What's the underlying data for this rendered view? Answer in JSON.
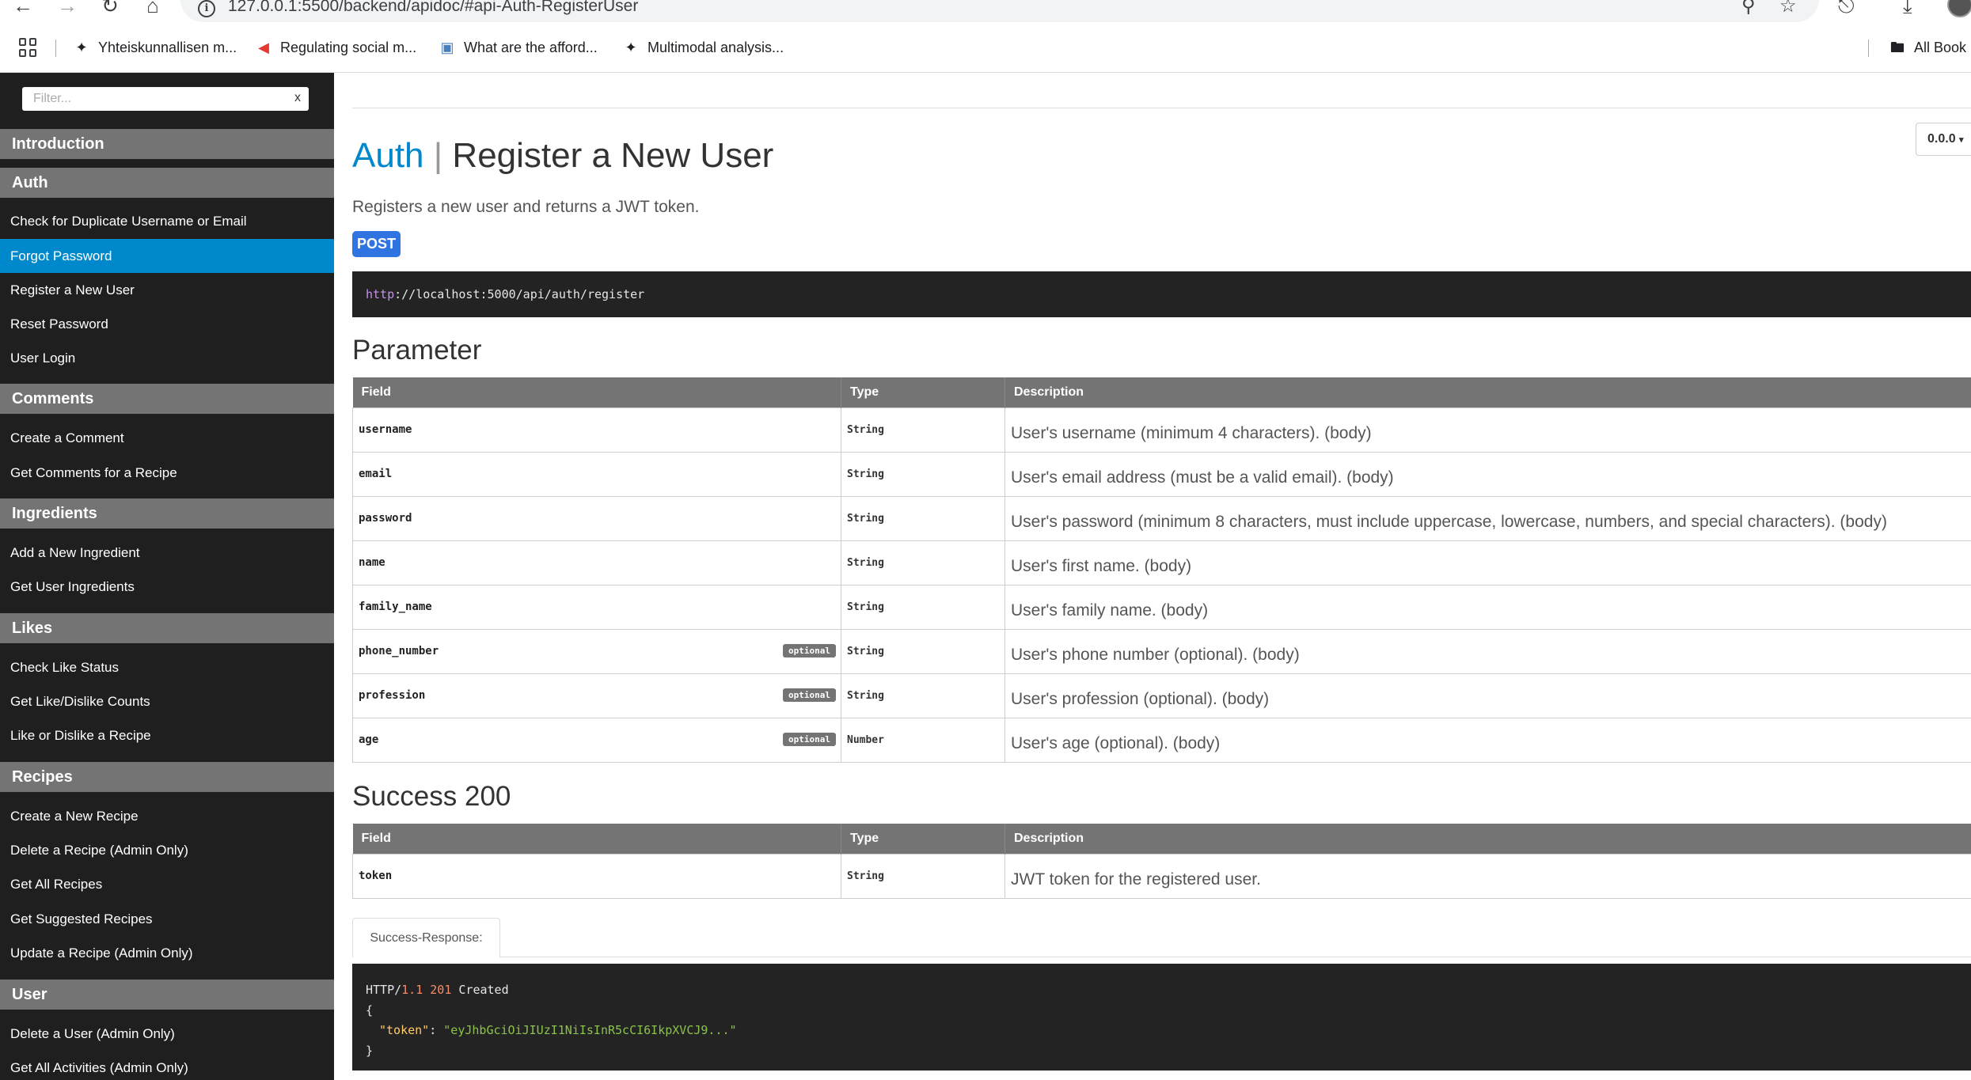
{
  "browser": {
    "url": "127.0.0.1:5500/backend/apidoc/#api-Auth-RegisterUser",
    "bookmarks": [
      {
        "label": "Yhteiskunnallisen m...",
        "icon": "bird-icon"
      },
      {
        "label": "Regulating social m...",
        "icon": "red-arrow-icon"
      },
      {
        "label": "What are the afford...",
        "icon": "image-icon"
      },
      {
        "label": "Multimodal analysis...",
        "icon": "bird-icon"
      }
    ],
    "all_bookmarks": "All Book"
  },
  "sidebar": {
    "filter_placeholder": "Filter...",
    "filter_clear": "x",
    "sections": [
      {
        "header": "Introduction",
        "items": []
      },
      {
        "header": "Auth",
        "items": [
          "Check for Duplicate Username or Email",
          "Forgot Password",
          "Register a New User",
          "Reset Password",
          "User Login"
        ]
      },
      {
        "header": "Comments",
        "items": [
          "Create a Comment",
          "Get Comments for a Recipe"
        ]
      },
      {
        "header": "Ingredients",
        "items": [
          "Add a New Ingredient",
          "Get User Ingredients"
        ]
      },
      {
        "header": "Likes",
        "items": [
          "Check Like Status",
          "Get Like/Dislike Counts",
          "Like or Dislike a Recipe"
        ]
      },
      {
        "header": "Recipes",
        "items": [
          "Create a New Recipe",
          "Delete a Recipe (Admin Only)",
          "Get All Recipes",
          "Get Suggested Recipes",
          "Update a Recipe (Admin Only)"
        ]
      },
      {
        "header": "User",
        "items": [
          "Delete a User (Admin Only)",
          "Get All Activities (Admin Only)"
        ]
      }
    ],
    "active_item": "Forgot Password"
  },
  "main": {
    "version": "0.0.0",
    "group": "Auth",
    "separator": "|",
    "title": "Register a New User",
    "description": "Registers a new user and returns a JWT token.",
    "method": "POST",
    "endpoint_proto": "http",
    "endpoint_rest": "://localhost:5000/api/auth/register",
    "parameter_title": "Parameter",
    "columns": {
      "field": "Field",
      "type": "Type",
      "description": "Description"
    },
    "parameters": [
      {
        "field": "username",
        "optional": false,
        "type": "String",
        "description": "User's username (minimum 4 characters). (body)"
      },
      {
        "field": "email",
        "optional": false,
        "type": "String",
        "description": "User's email address (must be a valid email). (body)"
      },
      {
        "field": "password",
        "optional": false,
        "type": "String",
        "description": "User's password (minimum 8 characters, must include uppercase, lowercase, numbers, and special characters). (body)"
      },
      {
        "field": "name",
        "optional": false,
        "type": "String",
        "description": "User's first name. (body)"
      },
      {
        "field": "family_name",
        "optional": false,
        "type": "String",
        "description": "User's family name. (body)"
      },
      {
        "field": "phone_number",
        "optional": true,
        "type": "String",
        "description": "User's phone number (optional). (body)"
      },
      {
        "field": "profession",
        "optional": true,
        "type": "String",
        "description": "User's profession (optional). (body)"
      },
      {
        "field": "age",
        "optional": true,
        "type": "Number",
        "description": "User's age (optional). (body)"
      }
    ],
    "optional_label": "optional",
    "success_title": "Success 200",
    "success_fields": [
      {
        "field": "token",
        "type": "String",
        "description": "JWT token for the registered user."
      }
    ],
    "example_tab": "Success-Response:",
    "response": {
      "protocol": "HTTP/",
      "version": "1.1",
      "status_code": "201",
      "status_text": "Created",
      "open_brace": "{",
      "key": "\"token\"",
      "colon": ": ",
      "value": "\"eyJhbGciOiJIUzI1NiIsInR5cCI6IkpXVCJ9...\"",
      "close_brace": "}"
    }
  }
}
